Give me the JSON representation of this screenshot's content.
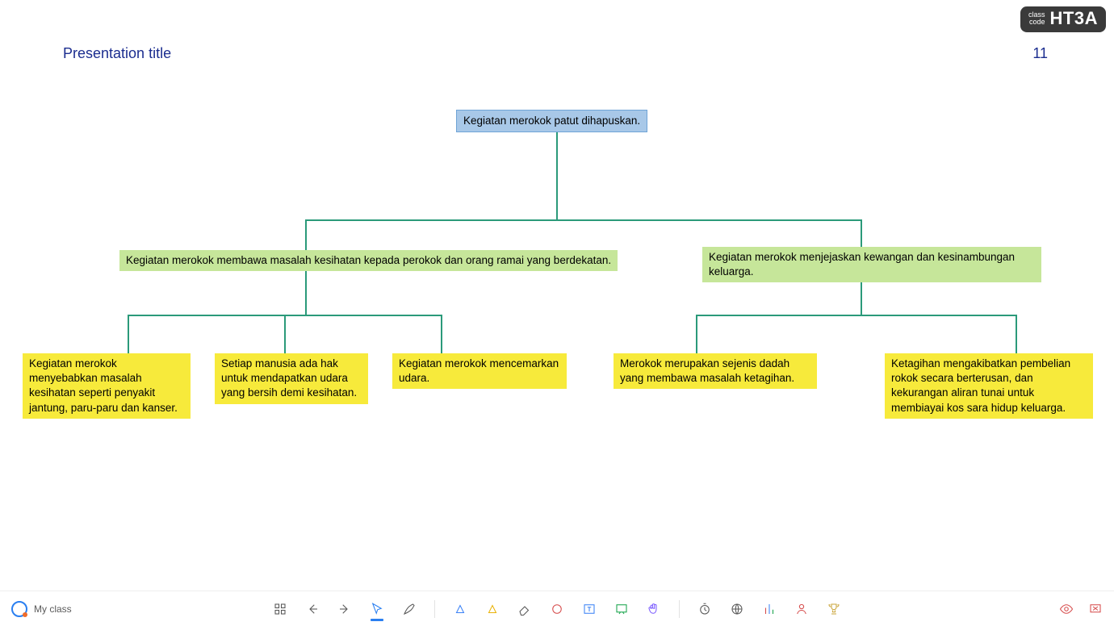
{
  "header": {
    "title": "Presentation title",
    "page_number": "11",
    "class_code_label_line1": "class",
    "class_code_label_line2": "code",
    "class_code": "HT3A"
  },
  "diagram": {
    "root": "Kegiatan merokok patut dihapuskan.",
    "branches": [
      {
        "label": "Kegiatan merokok membawa masalah kesihatan kepada perokok dan orang ramai yang berdekatan.",
        "leaves": [
          "Kegiatan merokok menyebabkan masalah kesihatan seperti penyakit jantung, paru-paru dan kanser.",
          "Setiap manusia ada hak untuk mendapatkan udara yang bersih demi kesihatan.",
          "Kegiatan merokok mencemarkan udara."
        ]
      },
      {
        "label": "Kegiatan merokok menjejaskan kewangan dan kesinambungan keluarga.",
        "leaves": [
          "Merokok merupakan sejenis dadah yang membawa masalah ketagihan.",
          "Ketagihan mengakibatkan pembelian rokok secara berterusan, dan kekurangan aliran tunai untuk membiayai kos sara hidup keluarga."
        ]
      }
    ]
  },
  "footer": {
    "brand_label": "My class"
  },
  "colors": {
    "root_bg": "#a8c8e8",
    "mid_bg": "#c6e69a",
    "leaf_bg": "#f7ea3b",
    "connector": "#2b9a7a",
    "title_text": "#1b2d8f"
  }
}
